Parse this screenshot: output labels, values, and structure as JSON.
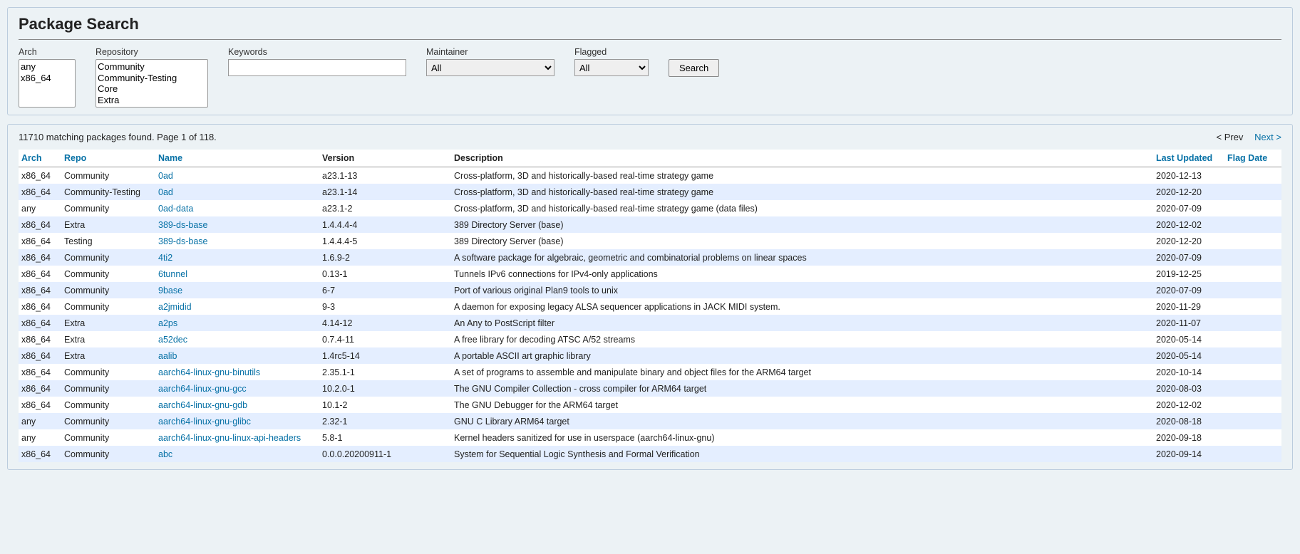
{
  "title": "Package Search",
  "form": {
    "arch_label": "Arch",
    "arch_options": [
      "any",
      "x86_64"
    ],
    "repo_label": "Repository",
    "repo_options": [
      "Community",
      "Community-Testing",
      "Core",
      "Extra"
    ],
    "keywords_label": "Keywords",
    "keywords_value": "",
    "maintainer_label": "Maintainer",
    "maintainer_selected": "All",
    "flagged_label": "Flagged",
    "flagged_selected": "All",
    "search_button": "Search"
  },
  "results_meta": "11710 matching packages found. Page 1 of 118.",
  "pager": {
    "prev": "< Prev",
    "next": "Next >"
  },
  "columns": {
    "arch": "Arch",
    "repo": "Repo",
    "name": "Name",
    "version": "Version",
    "description": "Description",
    "last_updated": "Last Updated",
    "flag_date": "Flag Date"
  },
  "rows": [
    {
      "arch": "x86_64",
      "repo": "Community",
      "name": "0ad",
      "version": "a23.1-13",
      "desc": "Cross-platform, 3D and historically-based real-time strategy game",
      "updated": "2020-12-13",
      "flag": ""
    },
    {
      "arch": "x86_64",
      "repo": "Community-Testing",
      "name": "0ad",
      "version": "a23.1-14",
      "desc": "Cross-platform, 3D and historically-based real-time strategy game",
      "updated": "2020-12-20",
      "flag": ""
    },
    {
      "arch": "any",
      "repo": "Community",
      "name": "0ad-data",
      "version": "a23.1-2",
      "desc": "Cross-platform, 3D and historically-based real-time strategy game (data files)",
      "updated": "2020-07-09",
      "flag": ""
    },
    {
      "arch": "x86_64",
      "repo": "Extra",
      "name": "389-ds-base",
      "version": "1.4.4.4-4",
      "desc": "389 Directory Server (base)",
      "updated": "2020-12-02",
      "flag": ""
    },
    {
      "arch": "x86_64",
      "repo": "Testing",
      "name": "389-ds-base",
      "version": "1.4.4.4-5",
      "desc": "389 Directory Server (base)",
      "updated": "2020-12-20",
      "flag": ""
    },
    {
      "arch": "x86_64",
      "repo": "Community",
      "name": "4ti2",
      "version": "1.6.9-2",
      "desc": "A software package for algebraic, geometric and combinatorial problems on linear spaces",
      "updated": "2020-07-09",
      "flag": ""
    },
    {
      "arch": "x86_64",
      "repo": "Community",
      "name": "6tunnel",
      "version": "0.13-1",
      "desc": "Tunnels IPv6 connections for IPv4-only applications",
      "updated": "2019-12-25",
      "flag": ""
    },
    {
      "arch": "x86_64",
      "repo": "Community",
      "name": "9base",
      "version": "6-7",
      "desc": "Port of various original Plan9 tools to unix",
      "updated": "2020-07-09",
      "flag": ""
    },
    {
      "arch": "x86_64",
      "repo": "Community",
      "name": "a2jmidid",
      "version": "9-3",
      "desc": "A daemon for exposing legacy ALSA sequencer applications in JACK MIDI system.",
      "updated": "2020-11-29",
      "flag": ""
    },
    {
      "arch": "x86_64",
      "repo": "Extra",
      "name": "a2ps",
      "version": "4.14-12",
      "desc": "An Any to PostScript filter",
      "updated": "2020-11-07",
      "flag": ""
    },
    {
      "arch": "x86_64",
      "repo": "Extra",
      "name": "a52dec",
      "version": "0.7.4-11",
      "desc": "A free library for decoding ATSC A/52 streams",
      "updated": "2020-05-14",
      "flag": ""
    },
    {
      "arch": "x86_64",
      "repo": "Extra",
      "name": "aalib",
      "version": "1.4rc5-14",
      "desc": "A portable ASCII art graphic library",
      "updated": "2020-05-14",
      "flag": ""
    },
    {
      "arch": "x86_64",
      "repo": "Community",
      "name": "aarch64-linux-gnu-binutils",
      "version": "2.35.1-1",
      "desc": "A set of programs to assemble and manipulate binary and object files for the ARM64 target",
      "updated": "2020-10-14",
      "flag": ""
    },
    {
      "arch": "x86_64",
      "repo": "Community",
      "name": "aarch64-linux-gnu-gcc",
      "version": "10.2.0-1",
      "desc": "The GNU Compiler Collection - cross compiler for ARM64 target",
      "updated": "2020-08-03",
      "flag": ""
    },
    {
      "arch": "x86_64",
      "repo": "Community",
      "name": "aarch64-linux-gnu-gdb",
      "version": "10.1-2",
      "desc": "The GNU Debugger for the ARM64 target",
      "updated": "2020-12-02",
      "flag": ""
    },
    {
      "arch": "any",
      "repo": "Community",
      "name": "aarch64-linux-gnu-glibc",
      "version": "2.32-1",
      "desc": "GNU C Library ARM64 target",
      "updated": "2020-08-18",
      "flag": ""
    },
    {
      "arch": "any",
      "repo": "Community",
      "name": "aarch64-linux-gnu-linux-api-headers",
      "version": "5.8-1",
      "desc": "Kernel headers sanitized for use in userspace (aarch64-linux-gnu)",
      "updated": "2020-09-18",
      "flag": ""
    },
    {
      "arch": "x86_64",
      "repo": "Community",
      "name": "abc",
      "version": "0.0.0.20200911-1",
      "desc": "System for Sequential Logic Synthesis and Formal Verification",
      "updated": "2020-09-14",
      "flag": ""
    }
  ]
}
